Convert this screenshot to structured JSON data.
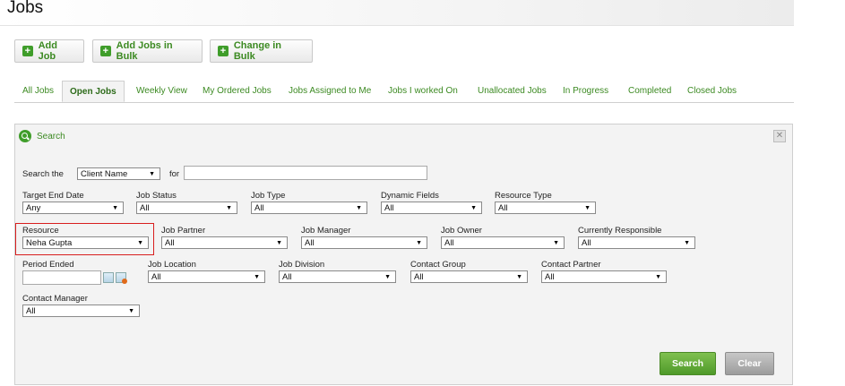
{
  "header": {
    "title": "Jobs"
  },
  "toolbar": {
    "add_job": "Add Job",
    "add_jobs_bulk": "Add Jobs in Bulk",
    "change_bulk": "Change in Bulk"
  },
  "tabs": [
    "All Jobs",
    "Open Jobs",
    "Weekly View",
    "My Ordered Jobs",
    "Jobs Assigned to Me",
    "Jobs I worked On",
    "Unallocated Jobs",
    "In Progress",
    "Completed",
    "Closed Jobs"
  ],
  "active_tab": "Open Jobs",
  "search_panel": {
    "title": "Search",
    "search_the_label": "Search the",
    "search_the_value": "Client Name",
    "for_label": "for",
    "for_value": "",
    "fields": {
      "target_end_date": {
        "label": "Target End Date",
        "value": "Any"
      },
      "job_status": {
        "label": "Job Status",
        "value": "All"
      },
      "job_type": {
        "label": "Job Type",
        "value": "All"
      },
      "dynamic_fields": {
        "label": "Dynamic Fields",
        "value": "All"
      },
      "resource_type": {
        "label": "Resource Type",
        "value": "All"
      },
      "resource": {
        "label": "Resource",
        "value": "Neha Gupta"
      },
      "job_partner": {
        "label": "Job Partner",
        "value": "All"
      },
      "job_manager": {
        "label": "Job Manager",
        "value": "All"
      },
      "job_owner": {
        "label": "Job Owner",
        "value": "All"
      },
      "currently_responsible": {
        "label": "Currently Responsible",
        "value": "All"
      },
      "period_ended": {
        "label": "Period Ended",
        "value": ""
      },
      "job_location": {
        "label": "Job Location",
        "value": "All"
      },
      "job_division": {
        "label": "Job Division",
        "value": "All"
      },
      "contact_group": {
        "label": "Contact Group",
        "value": "All"
      },
      "contact_partner": {
        "label": "Contact Partner",
        "value": "All"
      },
      "contact_manager": {
        "label": "Contact Manager",
        "value": "All"
      }
    },
    "search_button": "Search",
    "clear_button": "Clear"
  },
  "colors": {
    "accent_green": "#3c8a22",
    "highlight_red": "#d81e1e"
  }
}
